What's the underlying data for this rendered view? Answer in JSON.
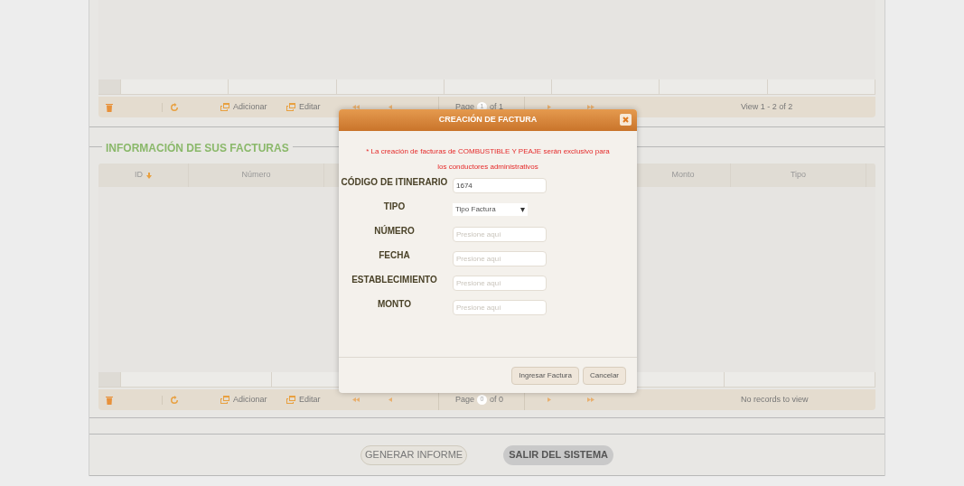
{
  "top_grid": {
    "pager": {
      "actions": [
        {
          "kind": "delete"
        },
        {
          "kind": "refresh"
        },
        {
          "kind": "add",
          "label": "Adicionar"
        },
        {
          "kind": "edit",
          "label": "Editar"
        }
      ],
      "page_label": "Page",
      "page_value": "1",
      "page_total": "of 1",
      "info": "View 1 - 2 of 2"
    }
  },
  "invoices": {
    "legend": "INFORMACIÓN DE SUS FACTURAS",
    "columns": [
      {
        "label": "ID",
        "sorted": true
      },
      {
        "label": "Número",
        "sorted": false
      },
      {
        "label": "Monto",
        "sorted": false
      },
      {
        "label": "Tipo",
        "sorted": false
      }
    ],
    "pager": {
      "actions": [
        {
          "kind": "delete"
        },
        {
          "kind": "refresh"
        },
        {
          "kind": "add",
          "label": "Adicionar"
        },
        {
          "kind": "edit",
          "label": "Editar"
        }
      ],
      "page_label": "Page",
      "page_value": "0",
      "page_total": "of 0",
      "info": "No records to view"
    }
  },
  "dialog": {
    "title": "CREACIÓN DE FACTURA",
    "notice": "* La creación de facturas de COMBUSTIBLE Y PEAJE serán exclusivo para los conductores administrativos",
    "fields": [
      {
        "label": "CÓDIGO DE ITINERARIO",
        "kind": "text",
        "value": "1674"
      },
      {
        "label": "TIPO",
        "kind": "select",
        "value": "Tipo Factura"
      },
      {
        "label": "NÚMERO",
        "kind": "text",
        "placeholder": "Presione aquí"
      },
      {
        "label": "FECHA",
        "kind": "text",
        "placeholder": "Presione aquí"
      },
      {
        "label": "ESTABLECIMIENTO",
        "kind": "text",
        "placeholder": "Presione aquí"
      },
      {
        "label": "MONTO",
        "kind": "text",
        "placeholder": "Presione aquí"
      }
    ],
    "buttons": [
      "Ingresar Factura",
      "Cancelar"
    ]
  },
  "footer_buttons": [
    {
      "label": "GENERAR INFORME",
      "kind": "outline"
    },
    {
      "label": "SALIR DEL SISTEMA",
      "kind": "filled"
    }
  ]
}
